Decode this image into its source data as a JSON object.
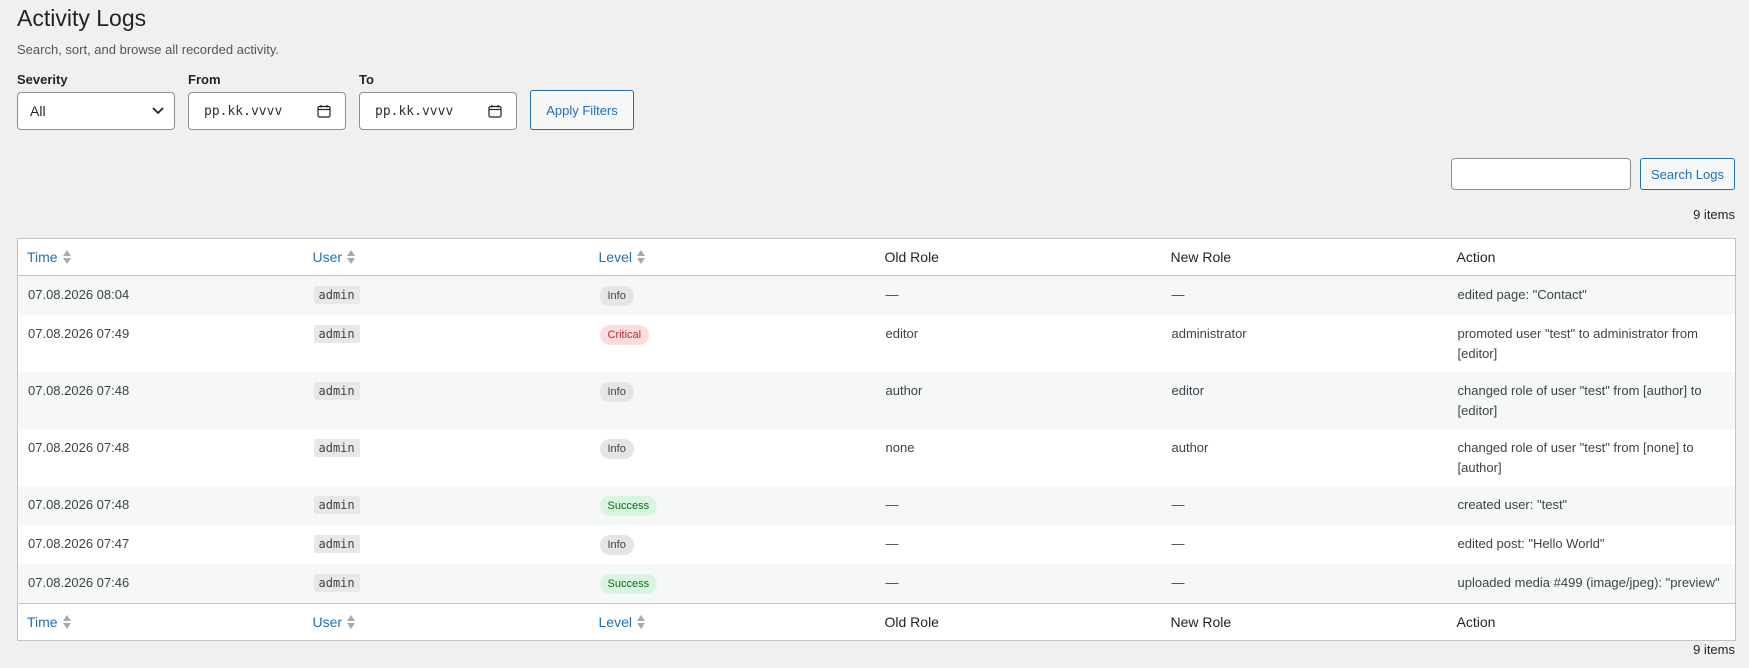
{
  "header": {
    "title": "Activity Logs",
    "subtitle": "Search, sort, and browse all recorded activity."
  },
  "filters": {
    "severity_label": "Severity",
    "severity_value": "All",
    "from_label": "From",
    "from_placeholder": "pp.kk.vvvv",
    "to_label": "To",
    "to_placeholder": "pp.kk.vvvv",
    "apply_label": "Apply Filters"
  },
  "search": {
    "value": "",
    "button_label": "Search Logs"
  },
  "item_count": "9 items",
  "table": {
    "columns": {
      "time": "Time",
      "user": "User",
      "level": "Level",
      "old_role": "Old Role",
      "new_role": "New Role",
      "action": "Action"
    },
    "rows": [
      {
        "time": "07.08.2026 08:04",
        "user": "admin",
        "level": "Info",
        "old_role": "—",
        "new_role": "—",
        "action": "edited page: \"Contact\""
      },
      {
        "time": "07.08.2026 07:49",
        "user": "admin",
        "level": "Critical",
        "old_role": "editor",
        "new_role": "administrator",
        "action": "promoted user \"test\" to administrator from [editor]"
      },
      {
        "time": "07.08.2026 07:48",
        "user": "admin",
        "level": "Info",
        "old_role": "author",
        "new_role": "editor",
        "action": "changed role of user \"test\" from [author] to [editor]"
      },
      {
        "time": "07.08.2026 07:48",
        "user": "admin",
        "level": "Info",
        "old_role": "none",
        "new_role": "author",
        "action": "changed role of user \"test\" from [none] to [author]"
      },
      {
        "time": "07.08.2026 07:48",
        "user": "admin",
        "level": "Success",
        "old_role": "—",
        "new_role": "—",
        "action": "created user: \"test\""
      },
      {
        "time": "07.08.2026 07:47",
        "user": "admin",
        "level": "Info",
        "old_role": "—",
        "new_role": "—",
        "action": "edited post: \"Hello World\""
      },
      {
        "time": "07.08.2026 07:46",
        "user": "admin",
        "level": "Success",
        "old_role": "—",
        "new_role": "—",
        "action": "uploaded media #499 (image/jpeg): \"preview\""
      }
    ]
  },
  "colors": {
    "link": "#2271b1",
    "background": "#f0f0f1",
    "critical": "#b32d2e",
    "success": "#007017"
  }
}
